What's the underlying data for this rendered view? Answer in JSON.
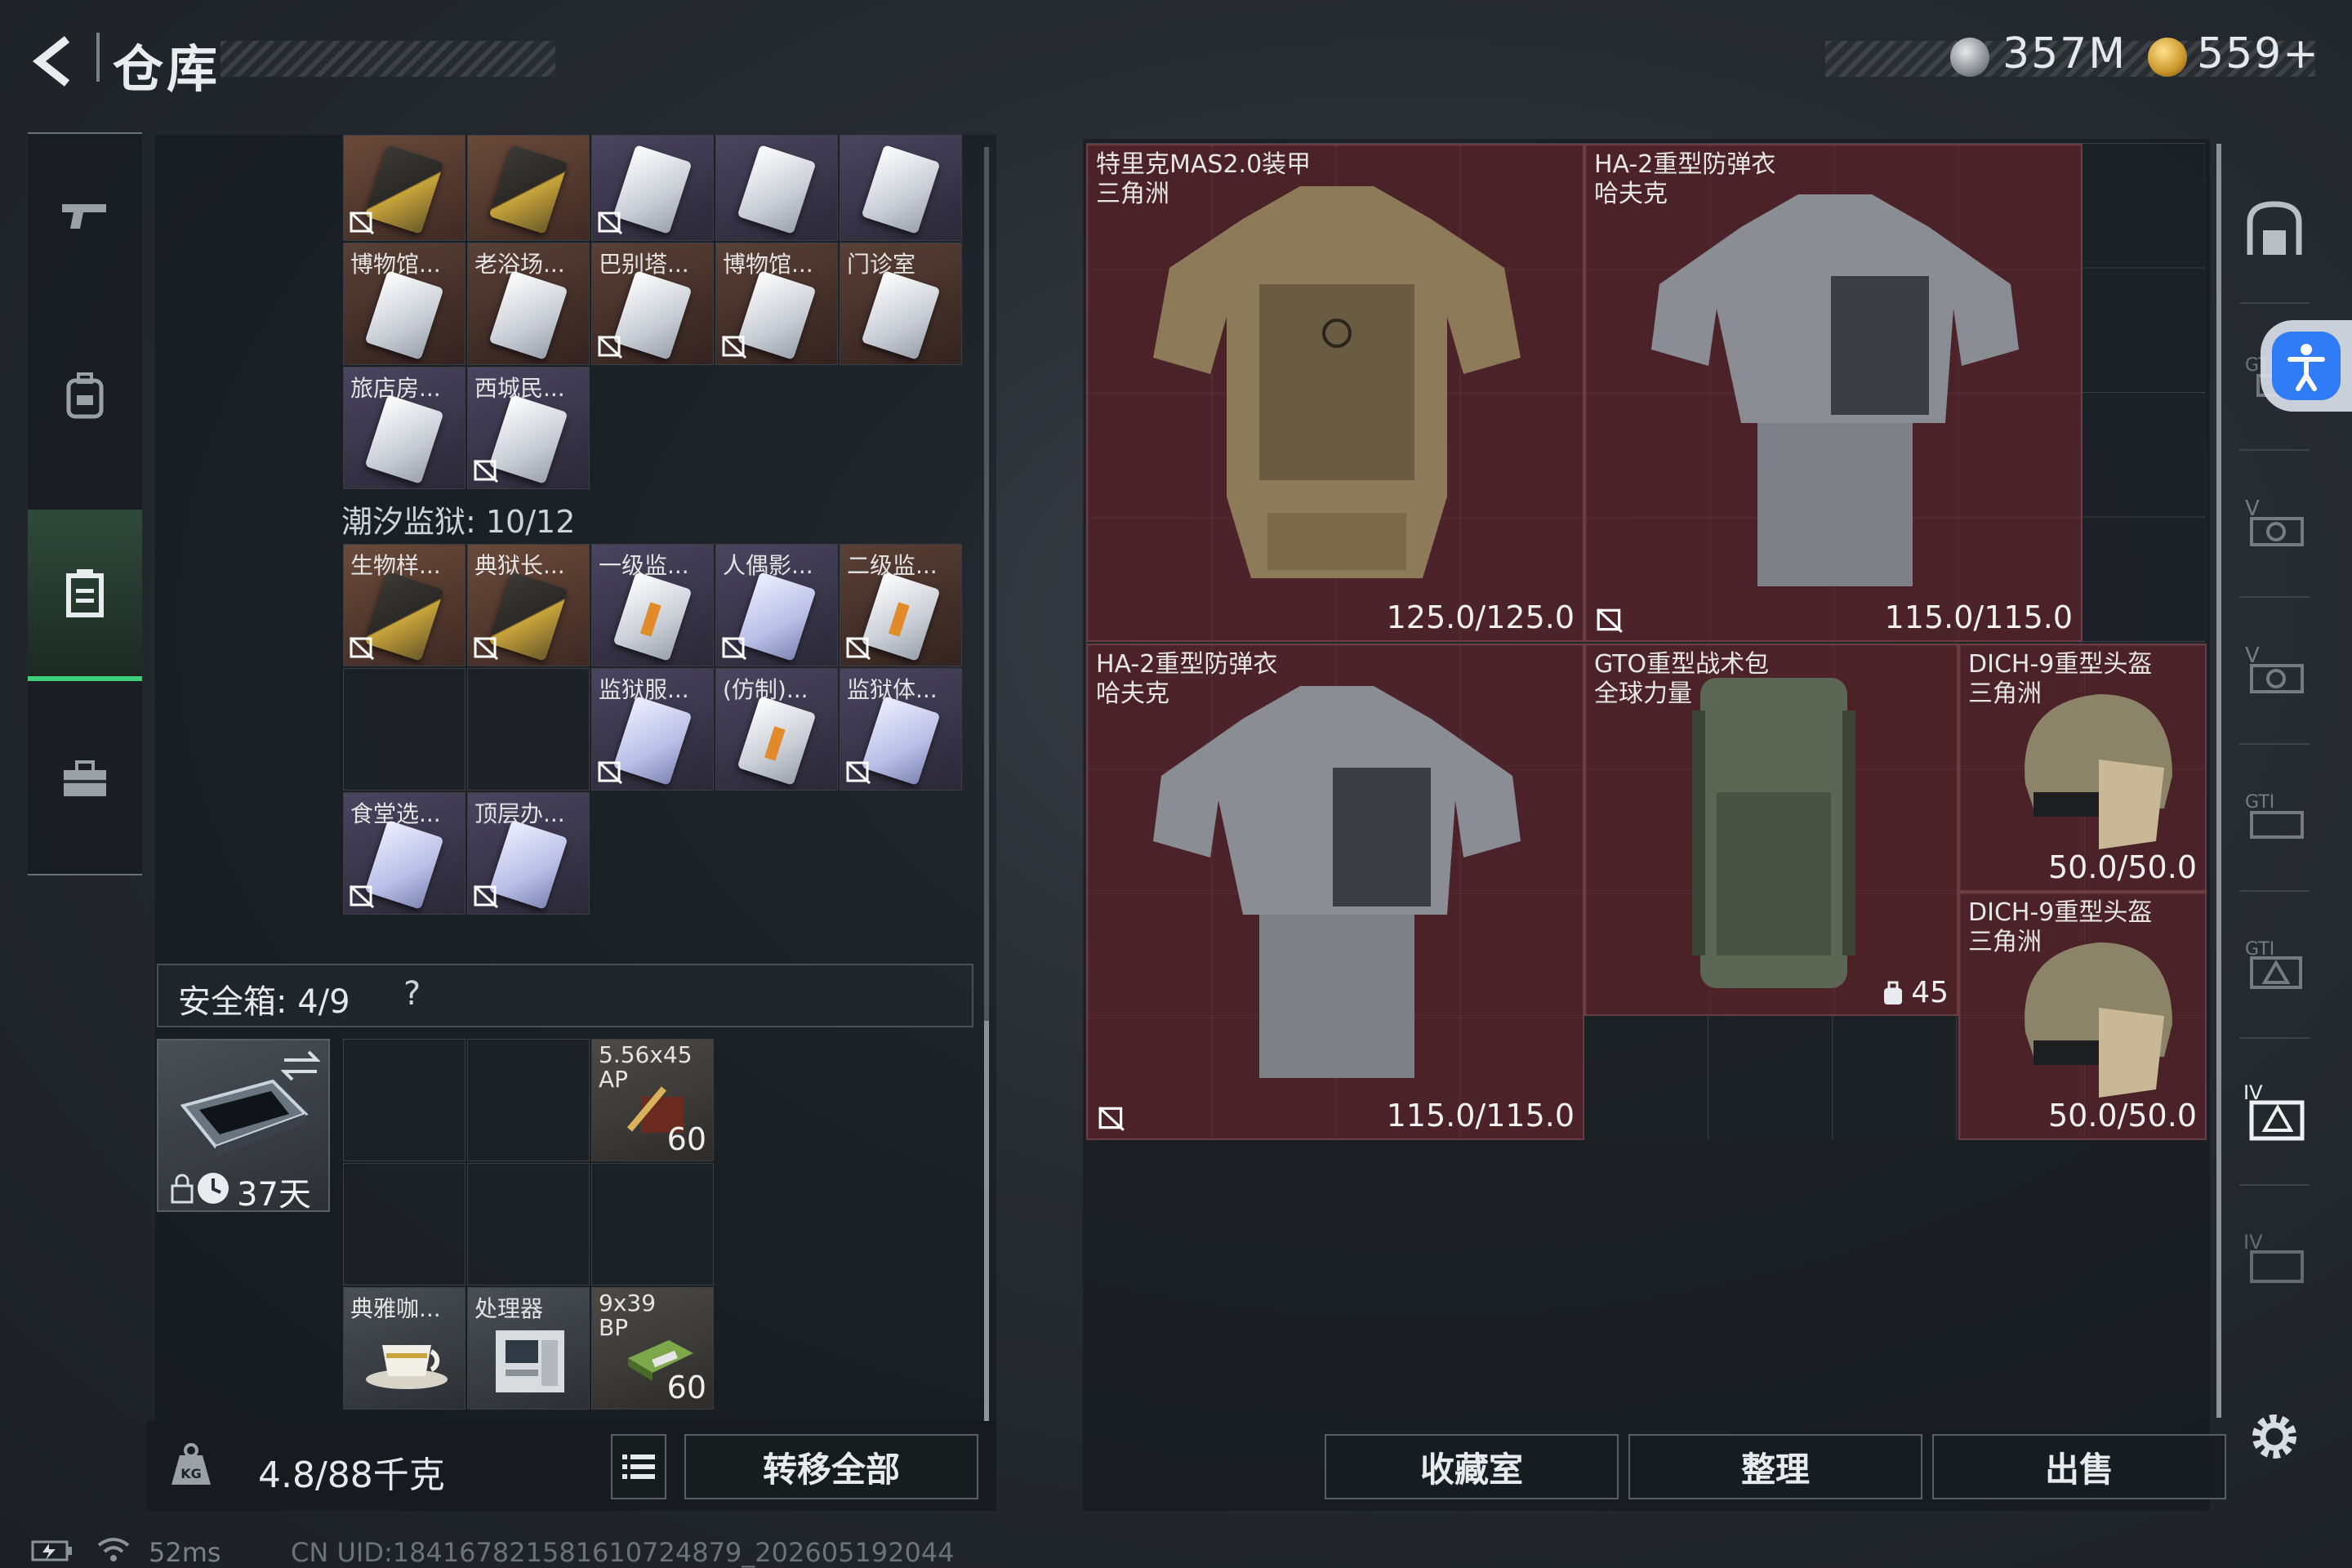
{
  "header": {
    "title": "仓库",
    "currency_1": "357M",
    "currency_2": "559+"
  },
  "left": {
    "top_row_partial": [
      "",
      "",
      "",
      "",
      ""
    ],
    "row2": [
      "博物馆...",
      "老浴场...",
      "巴别塔...",
      "博物馆...",
      "门诊室"
    ],
    "row3": [
      "旅店房...",
      "西城民..."
    ],
    "section_label": "潮汐监狱: 10/12",
    "prison_row1": [
      "生物样...",
      "典狱长...",
      "一级监...",
      "人偶影...",
      "二级监..."
    ],
    "prison_row2": [
      "监狱服...",
      "(仿制)...",
      "监狱体..."
    ],
    "prison_row3": [
      "食堂选...",
      "顶层办..."
    ],
    "safe_box_label": "安全箱: 4/9",
    "safe_box_help": "?",
    "safe_box_days": "37天",
    "safe_items": [
      {
        "name": "5.56x45\nAP",
        "count": "60"
      },
      {
        "name": "典雅咖...",
        "count": ""
      },
      {
        "name": "处理器",
        "count": ""
      },
      {
        "name": "9x39\nBP",
        "count": "60"
      }
    ],
    "weight": "4.8/88千克",
    "transfer_all": "转移全部"
  },
  "right": {
    "items": [
      {
        "name": "特里克MAS2.0装甲",
        "sub": "三角洲",
        "durability": "125.0/125.0"
      },
      {
        "name": "HA-2重型防弹衣",
        "sub": "哈夫克",
        "durability": "115.0/115.0"
      },
      {
        "name": "HA-2重型防弹衣",
        "sub": "哈夫克",
        "durability": "115.0/115.0"
      },
      {
        "name": "GTO重型战术包",
        "sub": "全球力量",
        "count": "45"
      },
      {
        "name": "DICH-9重型头盔",
        "sub": "三角洲",
        "durability": "50.0/50.0"
      },
      {
        "name": "DICH-9重型头盔",
        "sub": "三角洲",
        "durability": "50.0/50.0"
      }
    ],
    "buttons": [
      "收藏室",
      "整理",
      "出售"
    ]
  },
  "footer": {
    "ping": "52ms",
    "uid": "CN UID:184167821581610724879_202605192044"
  },
  "colors": {
    "accent_green": "#3ecf7a",
    "item_red": "#5a232a",
    "accessibility_blue": "#2f7cf6"
  }
}
